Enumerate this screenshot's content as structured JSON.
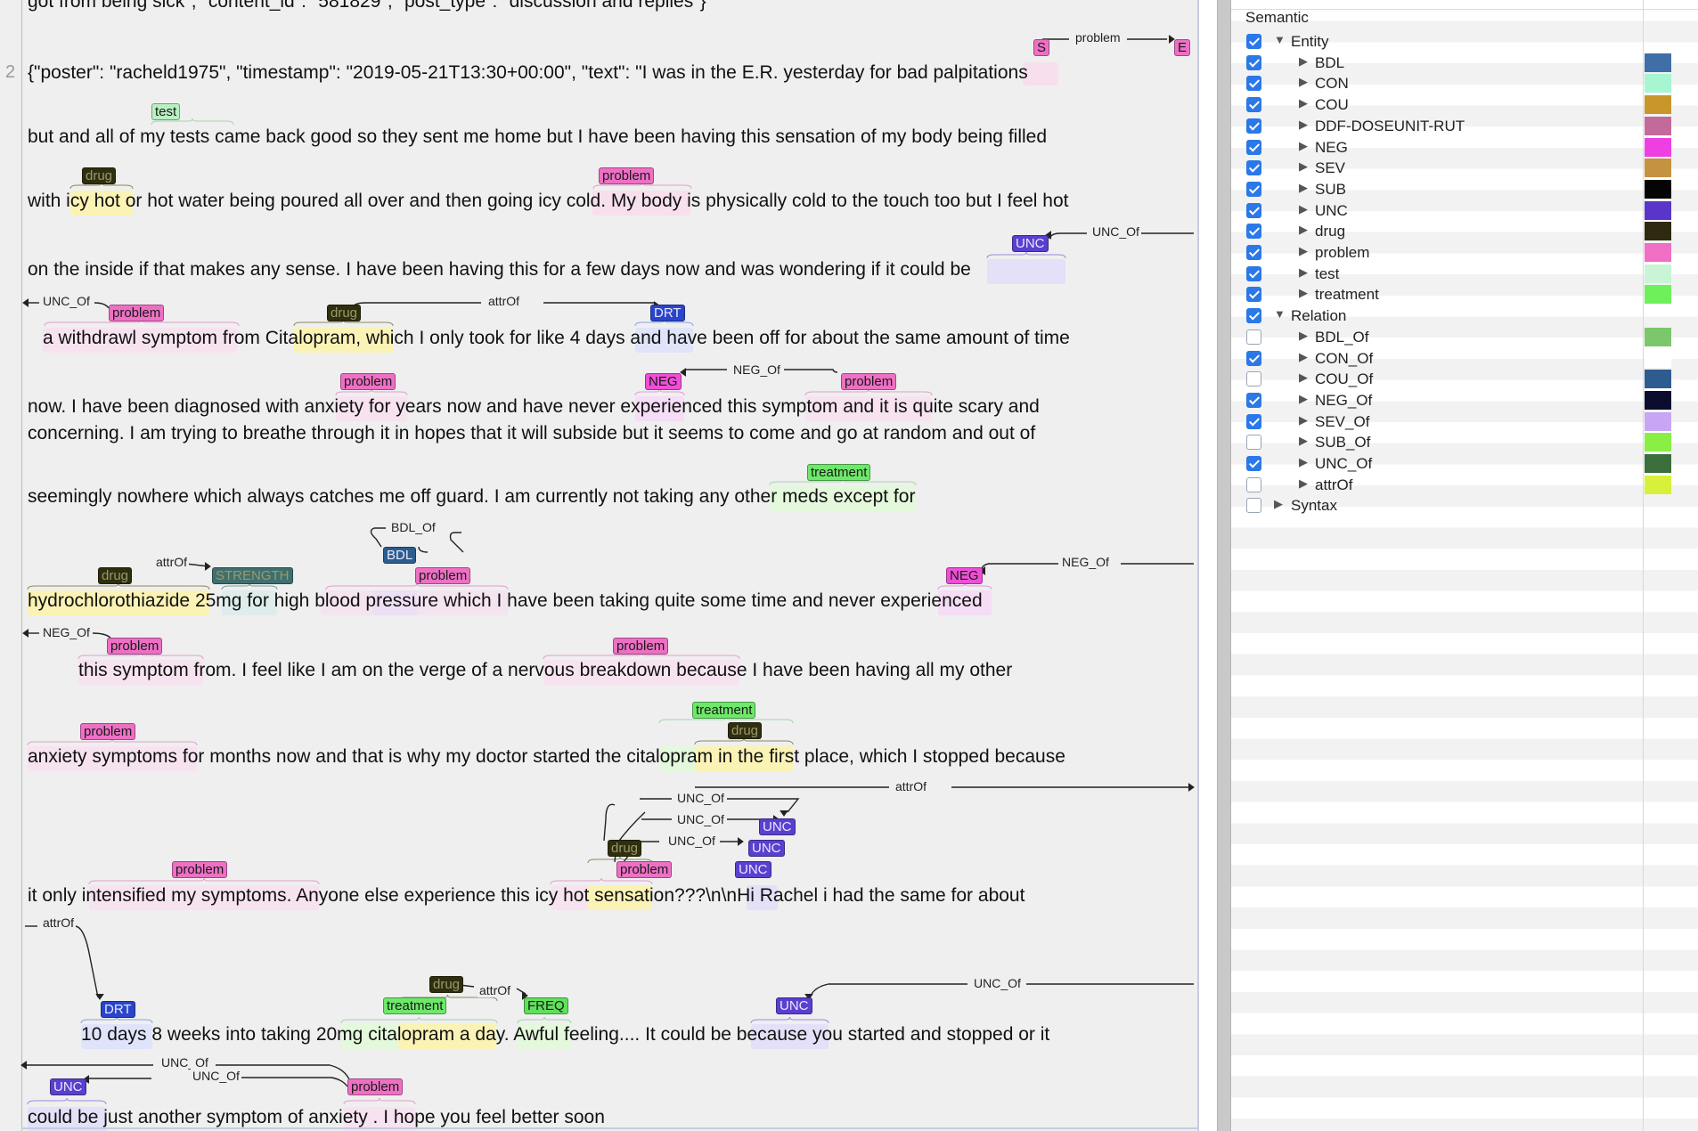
{
  "doc": {
    "top_line": "got from being sick\", \"content_id\": \"581829\", \"post_type\": \"discussion and replies\"}",
    "line_number": "2",
    "lines": [
      "{\"poster\": \"racheld1975\", \"timestamp\": \"2019-05-21T13:30+00:00\", \"text\": \"I was in the E.R. yesterday for bad  palpitations",
      "but and all of my tests came back good so they sent me home but I have been having this sensation of my body being filled",
      "with icy hot or hot water being poured all over and then going icy cold. My body is physically cold to the touch too but I feel hot",
      "on the inside if that makes any sense. I have been having this for a few days now and was wondering if it could be",
      "a withdrawl symptom from Citalopram, which I only took for like 4 days and have been off for about the same amount of time",
      "now. I have been diagnosed with  anxiety  for years now and have never experienced this symptom and it is quite scary and",
      "concerning. I am trying to breathe through it in hopes that it will subside but it seems to come and go at random and out of",
      "seemingly nowhere which always catches me off guard. I am currently not taking any other meds except for",
      "hydrochlorothiazide  25mg   for high blood pressure which I have been taking quite some time and never experienced",
      "this symptom from. I feel like I am on the verge of a nervous breakdown because I have been having all my other",
      "anxiety symptoms for months now and that is why my doctor started the citalopram in the first place, which I stopped because",
      "it only intensified my symptoms. Anyone else experience this icy hot sensation???\\n\\nHi Rachel i had the same for about",
      "10 days 8 weeks into taking 20mg citalopram   a day. Awful feeling.... It could be because you started and stopped or it",
      "could be just another symptom of  anxiety . I hope you feel better soon"
    ]
  },
  "colors": {
    "drug": "#2f2e0f",
    "problem": "#ee70c5",
    "test": "#b9f0c2",
    "treatment": "#6ee86a",
    "UNC": "#5b3fcf",
    "NEG": "#ee4fd6",
    "DRT": "#2a45c9",
    "BDL": "#2b5d8d",
    "STRENGTH": "#3f6f6f",
    "FREQ": "#5fe05b",
    "S": "#ee70c5",
    "E": "#ee70c5"
  },
  "labels": [
    {
      "text": "S",
      "type": "S"
    },
    {
      "text": "E",
      "type": "E"
    },
    {
      "text": "test",
      "type": "test"
    },
    {
      "text": "drug",
      "type": "drug"
    },
    {
      "text": "problem",
      "type": "problem"
    },
    {
      "text": "UNC",
      "type": "UNC"
    },
    {
      "text": "problem",
      "type": "problem"
    },
    {
      "text": "drug",
      "type": "drug"
    },
    {
      "text": "DRT",
      "type": "DRT"
    },
    {
      "text": "problem",
      "type": "problem"
    },
    {
      "text": "NEG",
      "type": "NEG"
    },
    {
      "text": "problem",
      "type": "problem"
    },
    {
      "text": "treatment",
      "type": "treatment"
    },
    {
      "text": "drug",
      "type": "drug"
    },
    {
      "text": "STRENGTH",
      "type": "STRENGTH"
    },
    {
      "text": "BDL",
      "type": "BDL"
    },
    {
      "text": "problem",
      "type": "problem"
    },
    {
      "text": "NEG",
      "type": "NEG"
    },
    {
      "text": "problem",
      "type": "problem"
    },
    {
      "text": "problem",
      "type": "problem"
    },
    {
      "text": "problem",
      "type": "problem"
    },
    {
      "text": "treatment",
      "type": "treatment"
    },
    {
      "text": "drug",
      "type": "drug"
    },
    {
      "text": "UNC",
      "type": "UNC"
    },
    {
      "text": "drug",
      "type": "drug"
    },
    {
      "text": "UNC",
      "type": "UNC"
    },
    {
      "text": "UNC",
      "type": "UNC"
    },
    {
      "text": "problem",
      "type": "problem"
    },
    {
      "text": "problem",
      "type": "problem"
    },
    {
      "text": "DRT",
      "type": "DRT"
    },
    {
      "text": "drug",
      "type": "drug"
    },
    {
      "text": "treatment",
      "type": "treatment"
    },
    {
      "text": "FREQ",
      "type": "FREQ"
    },
    {
      "text": "UNC",
      "type": "UNC"
    },
    {
      "text": "UNC",
      "type": "UNC"
    },
    {
      "text": "problem",
      "type": "problem"
    }
  ],
  "relations": [
    "problem",
    "UNC_Of",
    "UNC_Of",
    "attrOf",
    "NEG_Of",
    "BDL_Of",
    "attrOf",
    "NEG_Of",
    "NEG_Of",
    "attrOf",
    "UNC_Of",
    "UNC_Of",
    "UNC_Of",
    "attrOf",
    "attrOf",
    "UNC_Of",
    "UNC_Of",
    "UNC_Of"
  ],
  "panel": {
    "header": "Semantic",
    "rows": [
      {
        "label": "Entity",
        "level": 0,
        "checked": true,
        "expanded": true,
        "color": ""
      },
      {
        "label": "BDL",
        "level": 1,
        "checked": true,
        "color": "#3f6fa6"
      },
      {
        "label": "CON",
        "level": 1,
        "checked": true,
        "color": "#a8f5d2"
      },
      {
        "label": "COU",
        "level": 1,
        "checked": true,
        "color": "#c9962c"
      },
      {
        "label": "DDF-DOSEUNIT-RUT",
        "level": 1,
        "checked": true,
        "color": "#c26a9a"
      },
      {
        "label": "NEG",
        "level": 1,
        "checked": true,
        "color": "#ee3fe3"
      },
      {
        "label": "SEV",
        "level": 1,
        "checked": true,
        "color": "#c49340"
      },
      {
        "label": "SUB",
        "level": 1,
        "checked": true,
        "color": "#050505"
      },
      {
        "label": "UNC",
        "level": 1,
        "checked": true,
        "color": "#5a35c9"
      },
      {
        "label": "drug",
        "level": 1,
        "checked": true,
        "color": "#2e2a10"
      },
      {
        "label": "problem",
        "level": 1,
        "checked": true,
        "color": "#ef6fc4"
      },
      {
        "label": "test",
        "level": 1,
        "checked": true,
        "color": "#c9f5d6"
      },
      {
        "label": "treatment",
        "level": 1,
        "checked": true,
        "color": "#6ef05a"
      },
      {
        "label": "Relation",
        "level": 0,
        "checked": true,
        "expanded": true,
        "color": ""
      },
      {
        "label": "BDL_Of",
        "level": 1,
        "checked": false,
        "color": "#7cc76a"
      },
      {
        "label": "CON_Of",
        "level": 1,
        "checked": true,
        "color": "#ffffff"
      },
      {
        "label": "COU_Of",
        "level": 1,
        "checked": false,
        "color": "#2f5c8e"
      },
      {
        "label": "NEG_Of",
        "level": 1,
        "checked": true,
        "color": "#0c0c2e"
      },
      {
        "label": "SEV_Of",
        "level": 1,
        "checked": true,
        "color": "#c8a6f5"
      },
      {
        "label": "SUB_Of",
        "level": 1,
        "checked": false,
        "color": "#8aef44"
      },
      {
        "label": "UNC_Of",
        "level": 1,
        "checked": true,
        "color": "#3b6f3b"
      },
      {
        "label": "attrOf",
        "level": 1,
        "checked": false,
        "color": "#d9f03a"
      },
      {
        "label": "Syntax",
        "level": 0,
        "checked": false,
        "expanded": false,
        "color": ""
      }
    ]
  }
}
